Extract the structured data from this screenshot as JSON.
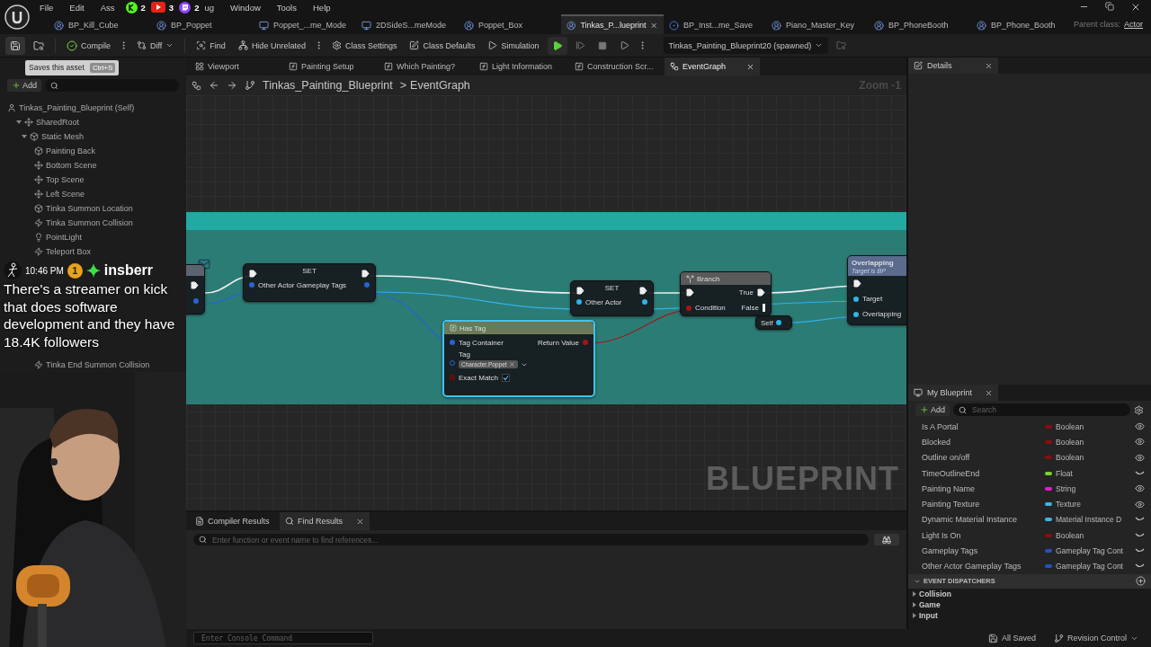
{
  "menu_before_badges": [
    "File",
    "Edit",
    "Ass"
  ],
  "stream_badges": [
    {
      "kind": "kick",
      "count": "2"
    },
    {
      "kind": "youtube",
      "count": "3"
    },
    {
      "kind": "twitch",
      "count": "2"
    }
  ],
  "menu_after_badges": [
    "ug",
    "Window",
    "Tools",
    "Help"
  ],
  "document_tabs": [
    {
      "label": "BP_Kill_Cube",
      "kind": "actor",
      "selected": false
    },
    {
      "label": "BP_Poppet",
      "kind": "actor",
      "selected": false
    },
    {
      "label": "Poppet_...me_Mode",
      "kind": "gamemode",
      "selected": false
    },
    {
      "label": "2DSideS...meMode",
      "kind": "gamemode",
      "selected": false
    },
    {
      "label": "Poppet_Box",
      "kind": "actor",
      "selected": false
    },
    {
      "label": "Tinkas_P...lueprint",
      "kind": "actor",
      "selected": true
    },
    {
      "label": "BP_Inst...me_Save",
      "kind": "savegame",
      "selected": false
    },
    {
      "label": "Piano_Master_Key",
      "kind": "actor",
      "selected": false
    },
    {
      "label": "BP_PhoneBooth",
      "kind": "actor",
      "selected": false
    },
    {
      "label": "BP_Phone_Booth",
      "kind": "actor",
      "selected": false
    }
  ],
  "parent_class": {
    "label": "Parent class:",
    "value": "Actor"
  },
  "toolbar": {
    "compile": "Compile",
    "diff": "Diff",
    "find": "Find",
    "hide_unrelated": "Hide Unrelated",
    "class_settings": "Class Settings",
    "class_defaults": "Class Defaults",
    "simulation": "Simulation",
    "debug_object": "Tinkas_Painting_Blueprint20 (spawned)"
  },
  "tooltip": {
    "text": "Saves this asset",
    "shortcut": "Ctrl+S"
  },
  "components": {
    "add": "Add",
    "self_item": "Tinkas_Painting_Blueprint (Self)",
    "tree": [
      {
        "label": "SharedRoot",
        "kind": "scene",
        "expanded": true,
        "children": [
          {
            "label": "Static Mesh",
            "kind": "mesh",
            "expanded": true,
            "children": [
              {
                "label": "Painting Back",
                "kind": "mesh"
              },
              {
                "label": "Bottom Scene",
                "kind": "scene"
              },
              {
                "label": "Top Scene",
                "kind": "scene"
              },
              {
                "label": "Left Scene",
                "kind": "scene"
              },
              {
                "label": "Tinka Summon Location",
                "kind": "mesh"
              },
              {
                "label": "Tinka Summon Collision",
                "kind": "collision"
              },
              {
                "label": "PointLight",
                "kind": "light"
              },
              {
                "label": "Teleport Box",
                "kind": "collision"
              }
            ]
          }
        ]
      }
    ],
    "tree_below_overlay": [
      {
        "label": "Tinka End Summon Collision",
        "kind": "collision"
      }
    ]
  },
  "chat_overlay": {
    "time": "10:46 PM",
    "badge": "1",
    "user": "insberr",
    "message": "There's a streamer on kick that does software development and they have 18.4K followers"
  },
  "webcam": {
    "kind": "picture"
  },
  "graph_tabs": [
    {
      "label": "Viewport",
      "kind": "viewport",
      "selected": false
    },
    {
      "label": "Painting Setup",
      "kind": "function",
      "selected": false
    },
    {
      "label": "Which Painting?",
      "kind": "function",
      "selected": false
    },
    {
      "label": "Light Information",
      "kind": "function",
      "selected": false
    },
    {
      "label": "Construction Scr...",
      "kind": "function",
      "selected": false
    },
    {
      "label": "EventGraph",
      "kind": "graph",
      "selected": true
    }
  ],
  "breadcrumb": {
    "blueprint": "Tinkas_Painting_Blueprint",
    "separator": ">",
    "graph": "EventGraph",
    "zoom": "Zoom -1"
  },
  "graph": {
    "watermark": "BLUEPRINT",
    "nodes": [
      {
        "kind": "stub"
      },
      {
        "kind": "set",
        "title": "SET",
        "pin": {
          "label": "Other Actor Gameplay Tags",
          "color": "#2a62d0"
        }
      },
      {
        "kind": "set",
        "title": "SET",
        "pin": {
          "label": "Other Actor",
          "color": "#2fb3e8"
        }
      },
      {
        "kind": "branch",
        "title": "Branch",
        "true_label": "True",
        "condition": "Condition",
        "false_label": "False"
      },
      {
        "kind": "self",
        "title": "Self"
      },
      {
        "kind": "call",
        "title": "Overlapping",
        "subtitle": "Target is BP",
        "pins": [
          "Target",
          "Overlapping"
        ]
      },
      {
        "kind": "pure_call",
        "title": "Has Tag",
        "input": "Tag Container",
        "output": "Return Value",
        "tag_label": "Tag",
        "tag_value": "Character.Poppet",
        "exact_match": "Exact Match",
        "exact_checked": true
      }
    ]
  },
  "bottom_tabs": [
    {
      "label": "Compiler Results",
      "kind": "log",
      "selected": false
    },
    {
      "label": "Find Results",
      "kind": "search",
      "selected": true
    }
  ],
  "find_placeholder": "Enter function or event name to find references...",
  "details_tab": "Details",
  "my_blueprint": {
    "tab": "My Blueprint",
    "add": "Add",
    "search_placeholder": "Search",
    "variables": [
      {
        "name": "Is A Portal",
        "type": "Boolean",
        "color": "#8c0d0d",
        "public": true
      },
      {
        "name": "Blocked",
        "type": "Boolean",
        "color": "#8c0d0d",
        "public": true
      },
      {
        "name": "Outline on/off",
        "type": "Boolean",
        "color": "#8c0d0d",
        "public": true
      },
      {
        "name": "TimeOutlineEnd",
        "type": "Float",
        "color": "#78d42c",
        "public": false
      },
      {
        "name": "Painting Name",
        "type": "String",
        "color": "#e01fc8",
        "public": true
      },
      {
        "name": "Painting Texture",
        "type": "Texture",
        "color": "#3db6e3",
        "public": true
      },
      {
        "name": "Dynamic Material Instance",
        "type": "Material Instance D",
        "color": "#3db6e3",
        "public": false
      },
      {
        "name": "Light Is On",
        "type": "Boolean",
        "color": "#8c0d0d",
        "public": false
      },
      {
        "name": "Gameplay Tags",
        "type": "Gameplay Tag Cont",
        "color": "#2452c4",
        "public": false
      },
      {
        "name": "Other Actor Gameplay Tags",
        "type": "Gameplay Tag Cont",
        "color": "#2452c4",
        "public": false
      }
    ],
    "event_dispatchers": "EVENT DISPATCHERS",
    "categories": [
      {
        "label": "Collision",
        "expanded": false
      },
      {
        "label": "Game",
        "expanded": false
      },
      {
        "label": "Input",
        "expanded": false
      }
    ]
  },
  "status": {
    "console_placeholder": "Enter Console Command",
    "saved": "All Saved",
    "revision": "Revision Control"
  }
}
